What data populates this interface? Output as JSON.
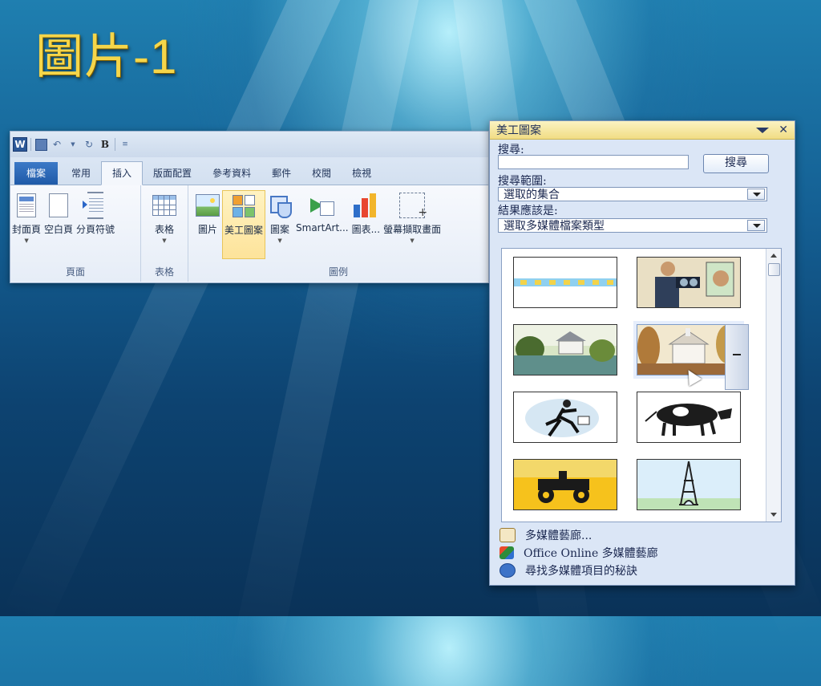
{
  "slide": {
    "title": "圖片-1"
  },
  "ribbon": {
    "tabs": [
      {
        "label": "檔案"
      },
      {
        "label": "常用"
      },
      {
        "label": "插入"
      },
      {
        "label": "版面配置"
      },
      {
        "label": "參考資料"
      },
      {
        "label": "郵件"
      },
      {
        "label": "校閱"
      },
      {
        "label": "檢視"
      }
    ],
    "groups": [
      {
        "name": "頁面",
        "buttons": [
          "封面頁",
          "空白頁",
          "分頁符號"
        ]
      },
      {
        "name": "表格",
        "buttons": [
          "表格"
        ]
      },
      {
        "name": "圖例",
        "buttons": [
          "圖片",
          "美工圖案",
          "圖案",
          "SmartArt...",
          "圖表...",
          "螢幕擷取畫面"
        ]
      }
    ]
  },
  "pane": {
    "title": "美工圖案",
    "search_label": "搜尋:",
    "search_value": "",
    "search_button": "搜尋",
    "scope_label": "搜尋範圍:",
    "scope_value": "選取的集合",
    "result_label": "結果應該是:",
    "result_value": "選取多媒體檔案類型",
    "clips": [
      "border-strip",
      "optometrist",
      "cottage-pond",
      "white-church",
      "running-man",
      "cow",
      "tractor",
      "eiffel-tower"
    ],
    "links": [
      "多媒體藝廊...",
      "Office Online 多媒體藝廊",
      "尋找多媒體項目的秘訣"
    ]
  },
  "colors": {
    "title": "#f5d64a",
    "file_tab": "#2b66c0",
    "pane_header": "#f1dd84"
  }
}
